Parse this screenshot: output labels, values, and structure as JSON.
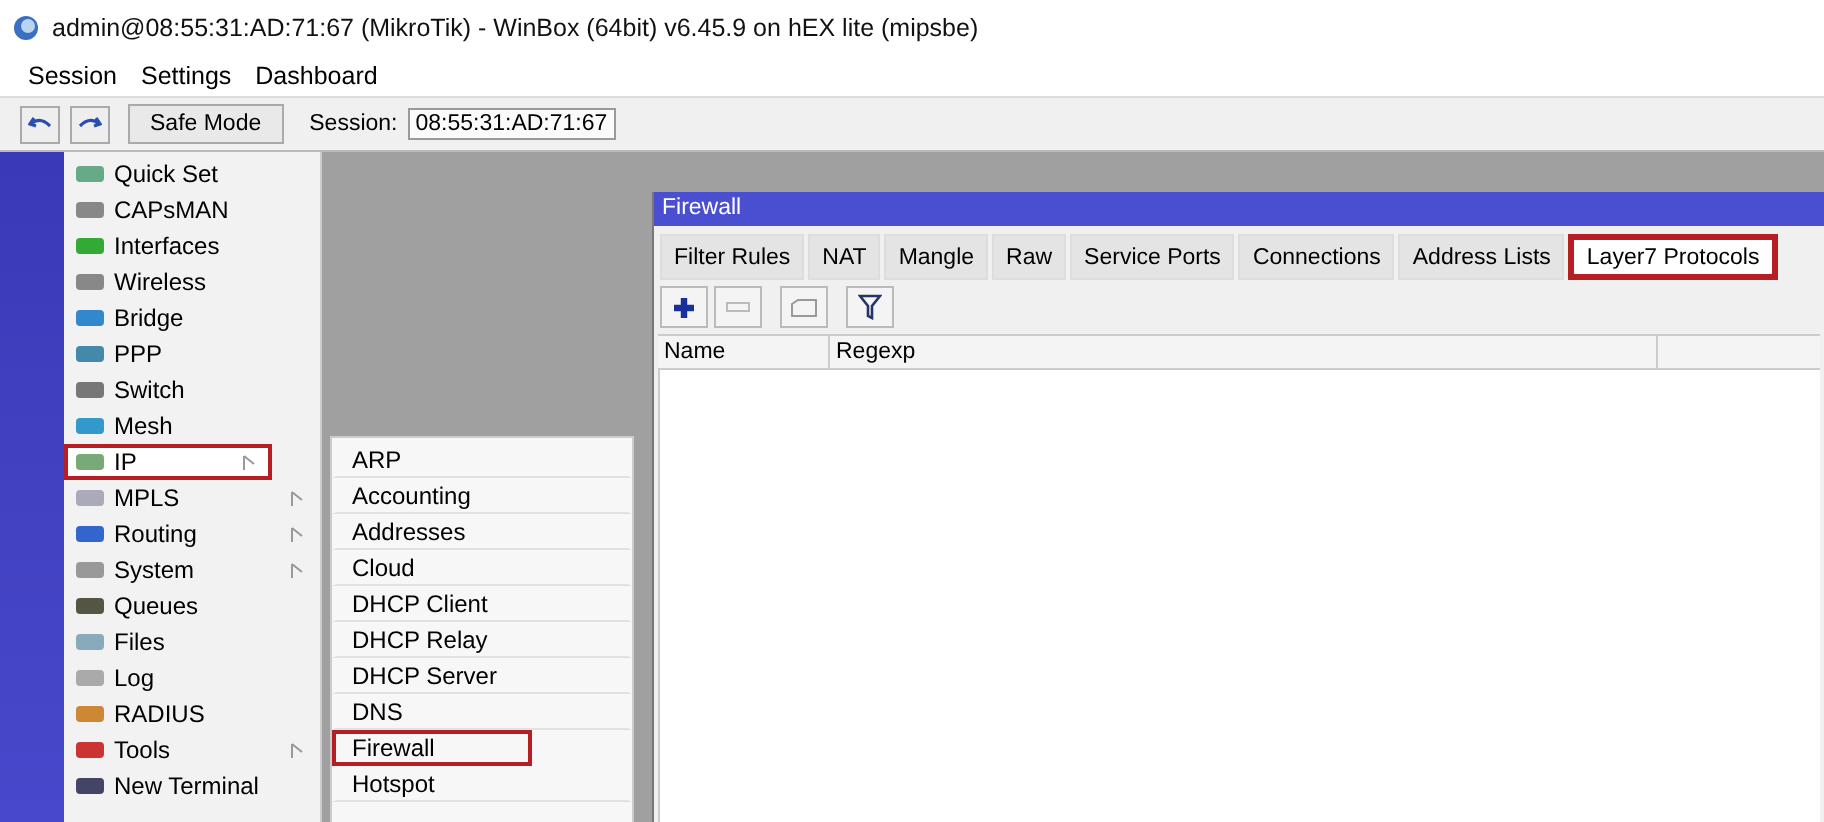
{
  "window": {
    "title": "admin@08:55:31:AD:71:67 (MikroTik) - WinBox (64bit) v6.45.9 on hEX lite (mipsbe)"
  },
  "menu": [
    "Session",
    "Settings",
    "Dashboard"
  ],
  "toolbar": {
    "safe_mode": "Safe Mode",
    "session_label": "Session:",
    "session_value": "08:55:31:AD:71:67"
  },
  "sidebar": {
    "items": [
      {
        "label": "Quick Set",
        "submenu": false,
        "highlighted": false
      },
      {
        "label": "CAPsMAN",
        "submenu": false,
        "highlighted": false
      },
      {
        "label": "Interfaces",
        "submenu": false,
        "highlighted": false
      },
      {
        "label": "Wireless",
        "submenu": false,
        "highlighted": false
      },
      {
        "label": "Bridge",
        "submenu": false,
        "highlighted": false
      },
      {
        "label": "PPP",
        "submenu": false,
        "highlighted": false
      },
      {
        "label": "Switch",
        "submenu": false,
        "highlighted": false
      },
      {
        "label": "Mesh",
        "submenu": false,
        "highlighted": false
      },
      {
        "label": "IP",
        "submenu": true,
        "highlighted": true
      },
      {
        "label": "MPLS",
        "submenu": true,
        "highlighted": false
      },
      {
        "label": "Routing",
        "submenu": true,
        "highlighted": false
      },
      {
        "label": "System",
        "submenu": true,
        "highlighted": false
      },
      {
        "label": "Queues",
        "submenu": false,
        "highlighted": false
      },
      {
        "label": "Files",
        "submenu": false,
        "highlighted": false
      },
      {
        "label": "Log",
        "submenu": false,
        "highlighted": false
      },
      {
        "label": "RADIUS",
        "submenu": false,
        "highlighted": false
      },
      {
        "label": "Tools",
        "submenu": true,
        "highlighted": false
      },
      {
        "label": "New Terminal",
        "submenu": false,
        "highlighted": false
      }
    ]
  },
  "submenu": {
    "items": [
      {
        "label": "ARP",
        "highlighted": false
      },
      {
        "label": "Accounting",
        "highlighted": false
      },
      {
        "label": "Addresses",
        "highlighted": false
      },
      {
        "label": "Cloud",
        "highlighted": false
      },
      {
        "label": "DHCP Client",
        "highlighted": false
      },
      {
        "label": "DHCP Relay",
        "highlighted": false
      },
      {
        "label": "DHCP Server",
        "highlighted": false
      },
      {
        "label": "DNS",
        "highlighted": false
      },
      {
        "label": "Firewall",
        "highlighted": true
      },
      {
        "label": "Hotspot",
        "highlighted": false
      }
    ]
  },
  "firewall": {
    "title": "Firewall",
    "tabs": [
      {
        "label": "Filter Rules",
        "selected": false,
        "highlighted": false
      },
      {
        "label": "NAT",
        "selected": false,
        "highlighted": false
      },
      {
        "label": "Mangle",
        "selected": false,
        "highlighted": false
      },
      {
        "label": "Raw",
        "selected": false,
        "highlighted": false
      },
      {
        "label": "Service Ports",
        "selected": false,
        "highlighted": false
      },
      {
        "label": "Connections",
        "selected": false,
        "highlighted": false
      },
      {
        "label": "Address Lists",
        "selected": false,
        "highlighted": false
      },
      {
        "label": "Layer7 Protocols",
        "selected": true,
        "highlighted": true
      }
    ],
    "columns": [
      "Name",
      "Regexp"
    ]
  }
}
